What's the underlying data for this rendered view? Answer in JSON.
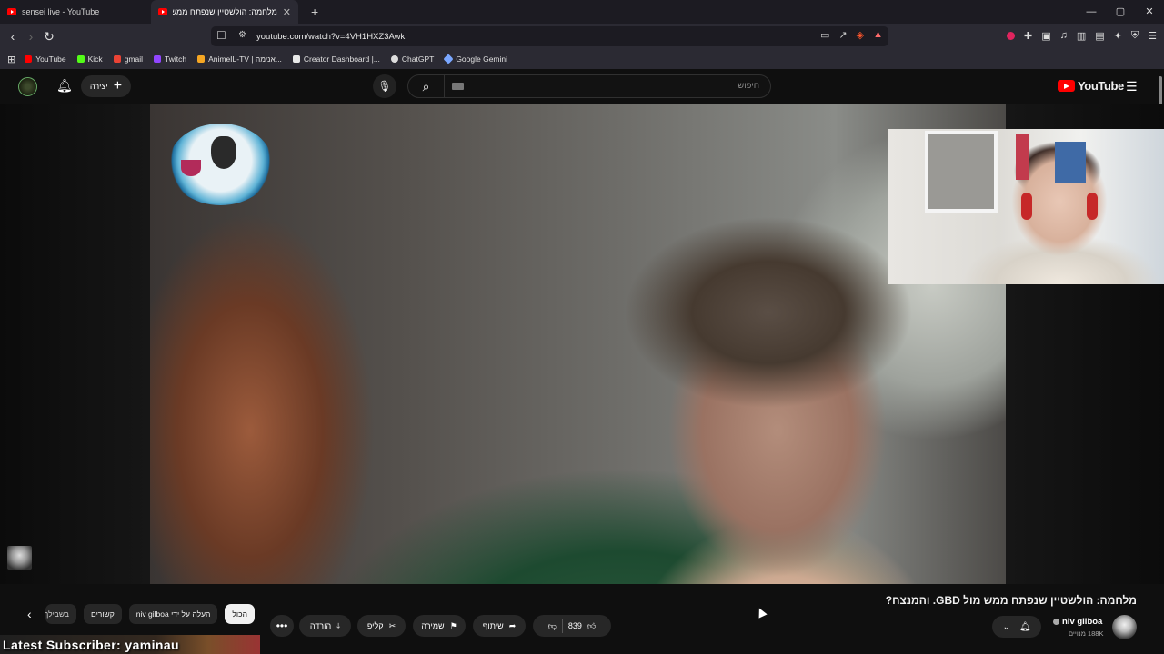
{
  "browser": {
    "tabs": [
      {
        "title": "sensei live - YouTube",
        "active": false
      },
      {
        "title": "מלחמה: הולשטיין שנפתח ממש מ",
        "active": true
      }
    ],
    "new_tab": "+",
    "url": "youtube.com/watch?v=4VH1HXZ3Awk",
    "window_controls": [
      "—",
      "▢",
      "✕"
    ]
  },
  "bookmarks": [
    {
      "label": "YouTube",
      "color": "#ff0000"
    },
    {
      "label": "Kick",
      "color": "#53fc18"
    },
    {
      "label": "gmail",
      "color": "#ea4335"
    },
    {
      "label": "Twitch",
      "color": "#9146ff"
    },
    {
      "label": "AnimeIL-TV | אנימה...",
      "color": "#f5a623"
    },
    {
      "label": "Creator Dashboard |...",
      "color": "#e8e8e8"
    },
    {
      "label": "ChatGPT",
      "color": "#dddddd"
    },
    {
      "label": "Google Gemini",
      "color": "#7aa7ff"
    }
  ],
  "youtube": {
    "create_label": "יצירה",
    "search_placeholder": "חיפוש",
    "logo_text": "YouTube"
  },
  "video": {
    "title": "מלחמה: הולשטיין שנפתח ממש מול GBD. והמנצח?",
    "channel": "niv gilboa",
    "subscribers": "188K מנויים",
    "likes": "839",
    "share_label": "שיתוף",
    "save_label": "שמירה",
    "clip_label": "קליפ",
    "download_label": "הורדה",
    "more_label": "•••"
  },
  "chips": {
    "all": "הכול",
    "by_uploader": "העלה על ידי niv gilboa",
    "related": "קשורים",
    "for_you": "בשבילך"
  },
  "overlay": {
    "latest_subscriber": "Latest Subscriber: yaminau"
  },
  "colors": {
    "youtube_red": "#ff0000",
    "background": "#0f0f0f",
    "pill": "#272727"
  }
}
